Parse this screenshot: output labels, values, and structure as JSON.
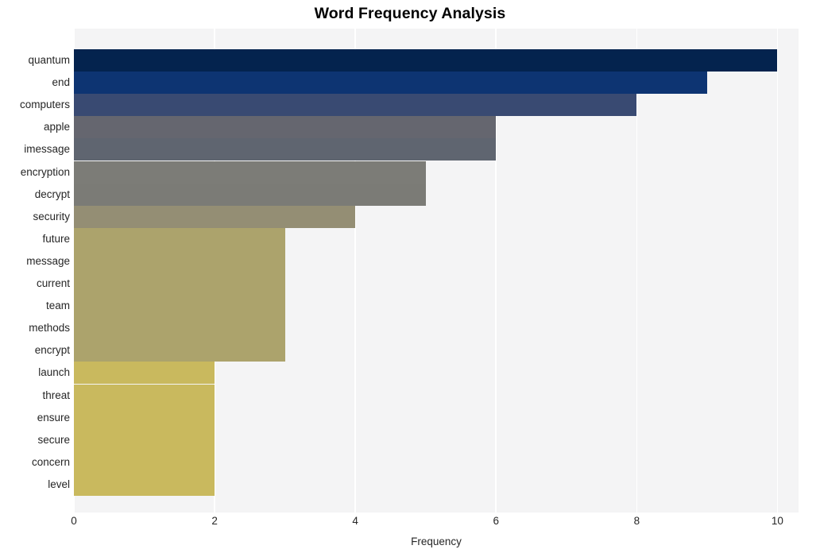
{
  "chart_data": {
    "type": "bar",
    "orientation": "horizontal",
    "title": "Word Frequency Analysis",
    "xlabel": "Frequency",
    "ylabel": "",
    "categories": [
      "quantum",
      "end",
      "computers",
      "apple",
      "imessage",
      "encryption",
      "decrypt",
      "security",
      "future",
      "message",
      "current",
      "team",
      "methods",
      "encrypt",
      "launch",
      "threat",
      "ensure",
      "secure",
      "concern",
      "level"
    ],
    "values": [
      10,
      9,
      8,
      6,
      6,
      5,
      5,
      4,
      3,
      3,
      3,
      3,
      3,
      3,
      2,
      2,
      2,
      2,
      2,
      2
    ],
    "bar_colors": [
      "#04234e",
      "#0d3472",
      "#394a72",
      "#65666f",
      "#5f6570",
      "#7c7c77",
      "#7b7b76",
      "#948e74",
      "#aca36c",
      "#aca36c",
      "#aca36c",
      "#aca36c",
      "#aca36c",
      "#aca36c",
      "#c9b95e",
      "#c9b95e",
      "#c9b95e",
      "#c9b95e",
      "#c9b95e",
      "#c9b95e"
    ],
    "xlim": [
      0,
      10.3
    ],
    "xticks": [
      0,
      2,
      4,
      6,
      8,
      10
    ],
    "xtick_labels": [
      "0",
      "2",
      "4",
      "6",
      "8",
      "10"
    ],
    "grid": true,
    "grid_axis": "x",
    "grid_color": "#ffffff",
    "plot_background": "#f4f4f5",
    "figure_background": "#ffffff",
    "legend": null
  }
}
